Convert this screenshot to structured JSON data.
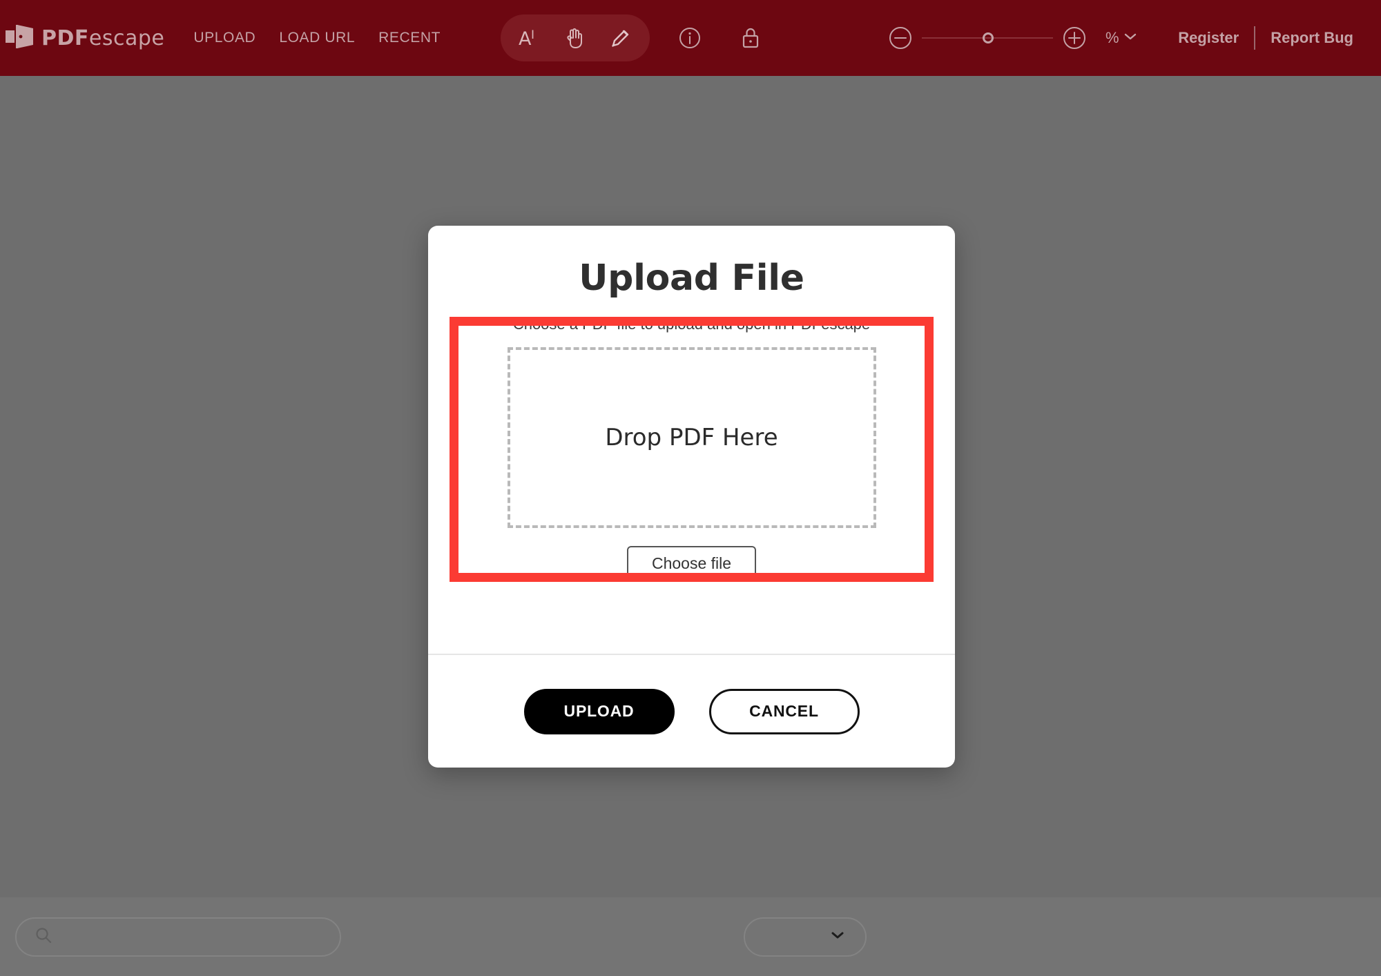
{
  "header": {
    "logo": {
      "icon": "pdfescape-door-icon",
      "text_bold": "PDF",
      "text_light": "escape"
    },
    "nav": [
      {
        "label": "UPLOAD",
        "name": "nav-upload"
      },
      {
        "label": "LOAD URL",
        "name": "nav-load-url"
      },
      {
        "label": "RECENT",
        "name": "nav-recent"
      }
    ],
    "tools": [
      {
        "name": "text-select-tool-icon",
        "title": "Text select"
      },
      {
        "name": "hand-pan-tool-icon",
        "title": "Pan"
      },
      {
        "name": "pencil-edit-tool-icon",
        "title": "Edit"
      }
    ],
    "standalone_icons": [
      {
        "name": "info-icon",
        "title": "Info"
      },
      {
        "name": "lock-icon",
        "title": "Lock"
      }
    ],
    "zoom": {
      "minus_icon": "zoom-out-icon",
      "plus_icon": "zoom-in-icon",
      "slider_value": 50,
      "percent_label": "%",
      "chevron_icon": "chevron-down-icon"
    },
    "right_links": [
      {
        "label": "Register",
        "name": "register-link"
      },
      {
        "label": "Report Bug",
        "name": "report-bug-link"
      }
    ]
  },
  "modal": {
    "title": "Upload File",
    "subtitle": "Choose a PDF file to upload and open in PDFescape",
    "dropzone_text": "Drop PDF Here",
    "choose_file_label": "Choose file",
    "upload_label": "UPLOAD",
    "cancel_label": "CANCEL"
  },
  "bottombar": {
    "search": {
      "icon": "search-icon",
      "value": "",
      "placeholder": ""
    },
    "page_select": {
      "value": "",
      "chevron_icon": "chevron-down-icon"
    }
  },
  "colors": {
    "header_red": "#6d0711",
    "overlay_gray": "#6e6e6e",
    "bottombar_gray": "#747474",
    "annotation_red": "#fb3b33",
    "accent_text": "#c4a2a6"
  }
}
